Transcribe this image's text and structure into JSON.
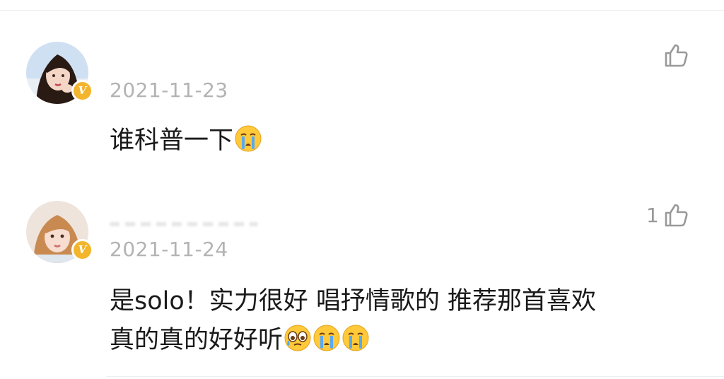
{
  "comments": [
    {
      "avatar": "user-avatar-1",
      "verified_badge": "V",
      "timestamp": "2021-11-23",
      "text": "谁科普一下",
      "emojis": [
        "crying-face"
      ],
      "like_icon": "thumbs-up-icon",
      "like_count": ""
    },
    {
      "avatar": "user-avatar-2",
      "verified_badge": "V",
      "timestamp": "2021-11-24",
      "text_line1": "是solo！实力很好 唱抒情歌的 推荐那首喜欢",
      "text_line2": "真的真的好好听",
      "emojis": [
        "teary-face",
        "crying-face",
        "crying-face"
      ],
      "like_icon": "thumbs-up-icon",
      "like_count": "1"
    }
  ],
  "colors": {
    "timestamp": "#b3b3b3",
    "text": "#1a1a1a",
    "badge": "#f2b52c",
    "icon": "#999999"
  }
}
